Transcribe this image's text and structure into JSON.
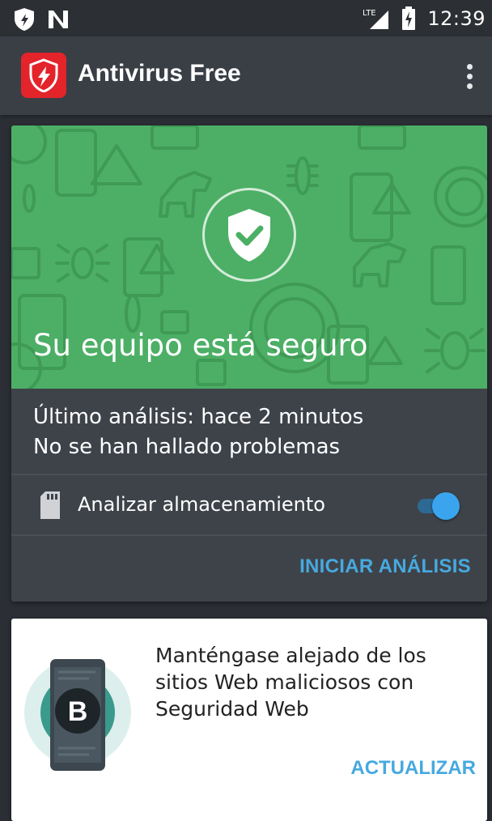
{
  "status_bar": {
    "network_label": "LTE",
    "time": "12:39",
    "icons": [
      "shield-notification-icon",
      "n-notification-icon",
      "lte-signal-icon",
      "battery-charging-icon"
    ]
  },
  "app_bar": {
    "title": "Antivirus Free",
    "logo_icon": "bitdefender-shield-logo",
    "menu_icon": "overflow-menu-icon"
  },
  "status_card": {
    "headline": "Su equipo está seguro",
    "last_scan": "Último análisis: hace 2 minutos",
    "problems": "No se han hallado problemas",
    "storage_toggle_label": "Analizar almacenamiento",
    "storage_toggle_on": true,
    "scan_button": "INICIAR ANÁLISIS",
    "colors": {
      "hero": "#4caf65",
      "accent": "#47a9df",
      "toggle": "#3aa5ee"
    }
  },
  "promo_card": {
    "text": "Manténgase alejado de los sitios Web maliciosos con Seguridad Web",
    "graphic_letter": "B",
    "update_button": "ACTUALIZAR"
  }
}
